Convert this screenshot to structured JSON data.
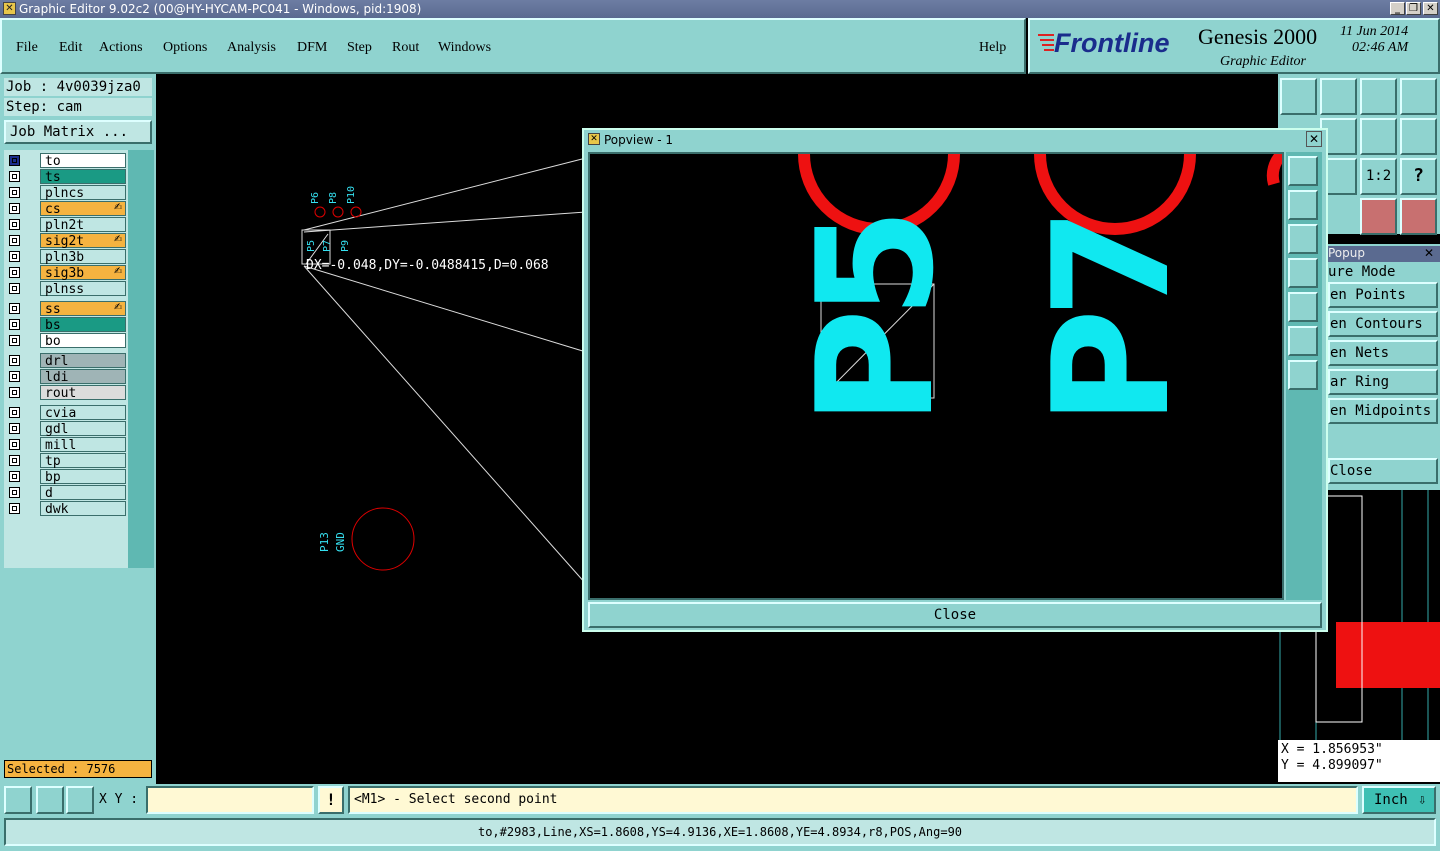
{
  "window": {
    "title": "Graphic Editor 9.02c2 (00@HY-HYCAM-PC041 - Windows, pid:1908)"
  },
  "menu": {
    "items": [
      "File",
      "Edit",
      "Actions",
      "Options",
      "Analysis",
      "DFM",
      "Step",
      "Rout",
      "Windows"
    ],
    "help": "Help"
  },
  "brand": {
    "logo": "Frontline",
    "product": "Genesis 2000",
    "subtitle": "Graphic Editor",
    "date": "11 Jun 2014",
    "time": "02:46 AM"
  },
  "job": {
    "job": "Job : 4v0039jza0",
    "step": "Step: cam",
    "matrix_button": "Job Matrix ..."
  },
  "layers": [
    {
      "name": "to",
      "color": "#ffffff",
      "selected": true
    },
    {
      "name": "ts",
      "color": "#1a9a84"
    },
    {
      "name": "plncs",
      "color": "#bfe6e3"
    },
    {
      "name": "cs",
      "color": "#f5b340",
      "hand": true
    },
    {
      "name": "pln2t",
      "color": "#bfe6e3"
    },
    {
      "name": "sig2t",
      "color": "#f5b340",
      "hand": true
    },
    {
      "name": "pln3b",
      "color": "#bfe6e3"
    },
    {
      "name": "sig3b",
      "color": "#f5b340",
      "hand": true
    },
    {
      "name": "plnss",
      "color": "#bfe6e3"
    },
    {
      "name": "ss",
      "color": "#f5b340",
      "hand": true
    },
    {
      "name": "bs",
      "color": "#1a9a84"
    },
    {
      "name": "bo",
      "color": "#ffffff"
    },
    {
      "name": "drl",
      "color": "#9fb4b6"
    },
    {
      "name": "ldi",
      "color": "#9fb4b6"
    },
    {
      "name": "rout",
      "color": "#dcdcdc"
    },
    {
      "name": "cvia",
      "color": "#bfe6e3"
    },
    {
      "name": "gdl",
      "color": "#bfe6e3"
    },
    {
      "name": "mill",
      "color": "#bfe6e3"
    },
    {
      "name": "tp",
      "color": "#bfe6e3"
    },
    {
      "name": "bp",
      "color": "#bfe6e3"
    },
    {
      "name": "d",
      "color": "#bfe6e3"
    },
    {
      "name": "dwk",
      "color": "#bfe6e3"
    }
  ],
  "selected": "Selected : 7576",
  "canvas": {
    "measure": "DX=-0.048,DY=-0.0488415,D=0.068",
    "pad_labels": [
      "P6",
      "P8",
      "P10",
      "P5",
      "P7",
      "P9"
    ],
    "lower_labels": [
      "P13",
      "GND"
    ]
  },
  "popview": {
    "title": "Popview - 1",
    "labels": [
      "P5",
      "P7"
    ],
    "close": "Close"
  },
  "side_popup": {
    "title": "Popup",
    "items": [
      "ure Mode",
      "en Points",
      "en Contours",
      "en Nets",
      "ar Ring",
      "en Midpoints"
    ],
    "close": "Close"
  },
  "coords": {
    "x": "X = 1.856953\"",
    "y": "Y = 4.899097\""
  },
  "bottom": {
    "xy_label": "X Y :",
    "xy_value": "",
    "prompt": "<M1> - Select second point",
    "unit": "Inch",
    "exclaim": "!"
  },
  "status": {
    "text": "to,#2983,Line,XS=1.8608,YS=4.9136,XE=1.8608,YE=4.8934,r8,POS,Ang=90"
  }
}
